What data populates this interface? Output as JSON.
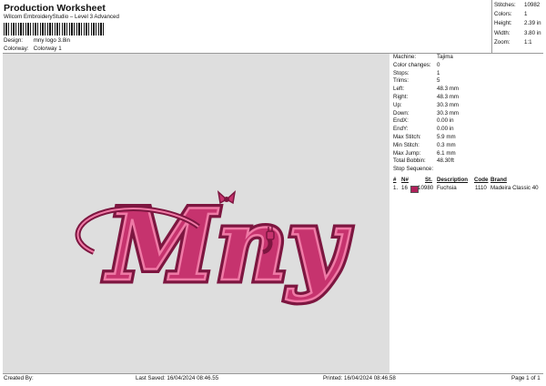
{
  "header": {
    "title": "Production Worksheet",
    "subtitle": "Wilcom EmbroideryStudio – Level 3 Advanced",
    "design_label": "Design:",
    "design_value": "mny logo 3.8in",
    "colorway_label": "Colorway:",
    "colorway_value": "Colorway 1"
  },
  "summary": [
    {
      "label": "Stitches:",
      "value": "10982"
    },
    {
      "label": "Colors:",
      "value": "1"
    },
    {
      "label": "Height:",
      "value": "2.39 in"
    },
    {
      "label": "Width:",
      "value": "3.80 in"
    },
    {
      "label": "Zoom:",
      "value": "1:1"
    }
  ],
  "details": [
    {
      "label": "Machine:",
      "value": "Tajima"
    },
    {
      "label": "Color changes:",
      "value": "0"
    },
    {
      "label": "Stops:",
      "value": "1"
    },
    {
      "label": "Trims:",
      "value": "5"
    },
    {
      "label": "Left:",
      "value": "48.3 mm"
    },
    {
      "label": "Right:",
      "value": "48.3 mm"
    },
    {
      "label": "Up:",
      "value": "30.3 mm"
    },
    {
      "label": "Down:",
      "value": "30.3 mm"
    },
    {
      "label": "EndX:",
      "value": "0.00 in"
    },
    {
      "label": "EndY:",
      "value": "0.00 in"
    },
    {
      "label": "Max Stitch:",
      "value": "5.9 mm"
    },
    {
      "label": "Min Stitch:",
      "value": "0.3 mm"
    },
    {
      "label": "Max Jump:",
      "value": "6.1 mm"
    },
    {
      "label": "Total Bobbin:",
      "value": "48.30ft"
    }
  ],
  "stop_sequence": {
    "title": "Stop Sequence:",
    "columns": [
      "#",
      "N#",
      "St.",
      "Description",
      "Code",
      "Brand"
    ],
    "rows": [
      {
        "num": "1.",
        "n": "16",
        "color": "#b0205a",
        "stitches": "10980",
        "description": "Fuchsia",
        "code": "1110",
        "brand": "Madeira Classic 40"
      }
    ]
  },
  "footer": {
    "created_by": "Created By:",
    "last_saved": "Last Saved: 16/04/2024 08:46.55",
    "printed": "Printed: 16/04/2024 08:46.58",
    "page": "Page 1 of 1"
  },
  "colors": {
    "thread": "#c6336e",
    "thread_light": "#ef7aa6",
    "thread_dark": "#7d1640",
    "preview_bg": "#dedede"
  },
  "preview": {
    "logo_text": "Mny"
  }
}
